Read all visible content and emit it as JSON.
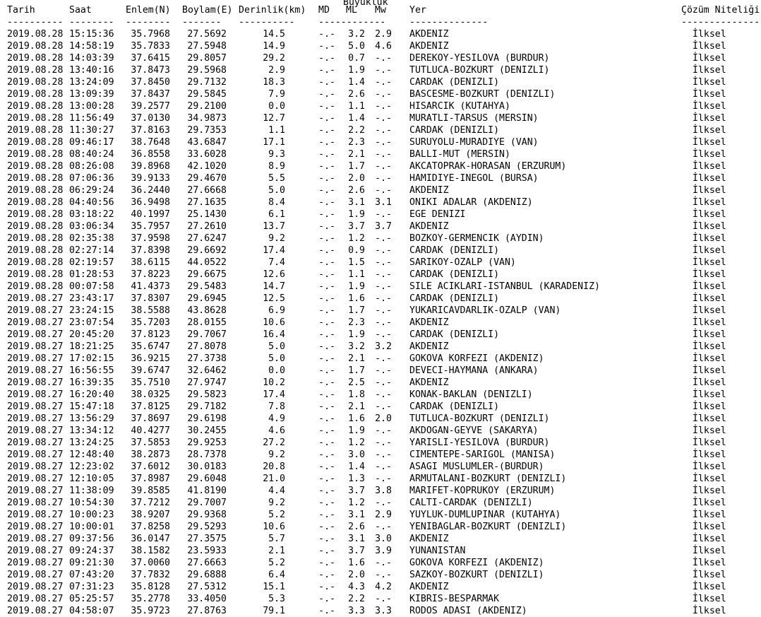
{
  "headers": {
    "magnitude_group": "Büyüklük",
    "date": "Tarih",
    "time": "Saat",
    "lat": "Enlem(N)",
    "lon": "Boylam(E)",
    "depth": "Derinlik(km)",
    "md": "MD",
    "ml": "ML",
    "mw": "Mw",
    "place": "Yer",
    "solution": "Çözüm Niteliği"
  },
  "dividers": {
    "date": "----------",
    "time": "--------",
    "lat": "--------",
    "lon": "-------",
    "depth": "----------",
    "mag": "------------",
    "place": "--------------",
    "solution": "--------------"
  },
  "rows": [
    {
      "date": "2019.08.28",
      "time": "15:15:36",
      "lat": "35.7968",
      "lon": "27.5692",
      "depth": "14.5",
      "md": "-.-",
      "ml": "3.2",
      "mw": "2.9",
      "place": "AKDENIZ",
      "solution": "İlksel"
    },
    {
      "date": "2019.08.28",
      "time": "14:58:19",
      "lat": "35.7833",
      "lon": "27.5948",
      "depth": "14.9",
      "md": "-.-",
      "ml": "5.0",
      "mw": "4.6",
      "place": "AKDENIZ",
      "solution": "İlksel"
    },
    {
      "date": "2019.08.28",
      "time": "14:03:39",
      "lat": "37.6415",
      "lon": "29.8057",
      "depth": "29.2",
      "md": "-.-",
      "ml": "0.7",
      "mw": "-.-",
      "place": "DEREKOY-YESILOVA (BURDUR)",
      "solution": "İlksel"
    },
    {
      "date": "2019.08.28",
      "time": "13:40:16",
      "lat": "37.8473",
      "lon": "29.5968",
      "depth": "2.9",
      "md": "-.-",
      "ml": "1.9",
      "mw": "-.-",
      "place": "TUTLUCA-BOZKURT (DENIZLI)",
      "solution": "İlksel"
    },
    {
      "date": "2019.08.28",
      "time": "13:24:09",
      "lat": "37.8450",
      "lon": "29.7132",
      "depth": "18.3",
      "md": "-.-",
      "ml": "1.4",
      "mw": "-.-",
      "place": "CARDAK (DENIZLI)",
      "solution": "İlksel"
    },
    {
      "date": "2019.08.28",
      "time": "13:09:39",
      "lat": "37.8437",
      "lon": "29.5845",
      "depth": "7.9",
      "md": "-.-",
      "ml": "2.6",
      "mw": "-.-",
      "place": "BASCESME-BOZKURT (DENIZLI)",
      "solution": "İlksel"
    },
    {
      "date": "2019.08.28",
      "time": "13:00:28",
      "lat": "39.2577",
      "lon": "29.2100",
      "depth": "0.0",
      "md": "-.-",
      "ml": "1.1",
      "mw": "-.-",
      "place": "HISARCIK (KUTAHYA)",
      "solution": "İlksel"
    },
    {
      "date": "2019.08.28",
      "time": "11:56:49",
      "lat": "37.0130",
      "lon": "34.9873",
      "depth": "12.7",
      "md": "-.-",
      "ml": "1.4",
      "mw": "-.-",
      "place": "MURATLI-TARSUS (MERSIN)",
      "solution": "İlksel"
    },
    {
      "date": "2019.08.28",
      "time": "11:30:27",
      "lat": "37.8163",
      "lon": "29.7353",
      "depth": "1.1",
      "md": "-.-",
      "ml": "2.2",
      "mw": "-.-",
      "place": "CARDAK (DENIZLI)",
      "solution": "İlksel"
    },
    {
      "date": "2019.08.28",
      "time": "09:46:17",
      "lat": "38.7648",
      "lon": "43.6847",
      "depth": "17.1",
      "md": "-.-",
      "ml": "2.3",
      "mw": "-.-",
      "place": "SURUYOLU-MURADIYE (VAN)",
      "solution": "İlksel"
    },
    {
      "date": "2019.08.28",
      "time": "08:40:24",
      "lat": "36.8558",
      "lon": "33.6028",
      "depth": "9.3",
      "md": "-.-",
      "ml": "2.1",
      "mw": "-.-",
      "place": "BALLI-MUT (MERSIN)",
      "solution": "İlksel"
    },
    {
      "date": "2019.08.28",
      "time": "08:26:08",
      "lat": "39.8968",
      "lon": "42.1020",
      "depth": "8.9",
      "md": "-.-",
      "ml": "1.7",
      "mw": "-.-",
      "place": "AKCATOPRAK-HORASAN (ERZURUM)",
      "solution": "İlksel"
    },
    {
      "date": "2019.08.28",
      "time": "07:06:36",
      "lat": "39.9133",
      "lon": "29.4670",
      "depth": "5.5",
      "md": "-.-",
      "ml": "2.0",
      "mw": "-.-",
      "place": "HAMIDIYE-INEGOL (BURSA)",
      "solution": "İlksel"
    },
    {
      "date": "2019.08.28",
      "time": "06:29:24",
      "lat": "36.2440",
      "lon": "27.6668",
      "depth": "5.0",
      "md": "-.-",
      "ml": "2.6",
      "mw": "-.-",
      "place": "AKDENIZ",
      "solution": "İlksel"
    },
    {
      "date": "2019.08.28",
      "time": "04:40:56",
      "lat": "36.9498",
      "lon": "27.1635",
      "depth": "8.4",
      "md": "-.-",
      "ml": "3.1",
      "mw": "3.1",
      "place": "ONIKI ADALAR (AKDENIZ)",
      "solution": "İlksel"
    },
    {
      "date": "2019.08.28",
      "time": "03:18:22",
      "lat": "40.1997",
      "lon": "25.1430",
      "depth": "6.1",
      "md": "-.-",
      "ml": "1.9",
      "mw": "-.-",
      "place": "EGE DENIZI",
      "solution": "İlksel"
    },
    {
      "date": "2019.08.28",
      "time": "03:06:34",
      "lat": "35.7957",
      "lon": "27.2610",
      "depth": "13.7",
      "md": "-.-",
      "ml": "3.7",
      "mw": "3.7",
      "place": "AKDENIZ",
      "solution": "İlksel"
    },
    {
      "date": "2019.08.28",
      "time": "02:35:38",
      "lat": "37.9598",
      "lon": "27.6247",
      "depth": "9.2",
      "md": "-.-",
      "ml": "1.2",
      "mw": "-.-",
      "place": "BOZKOY-GERMENCIK (AYDIN)",
      "solution": "İlksel"
    },
    {
      "date": "2019.08.28",
      "time": "02:27:14",
      "lat": "37.8398",
      "lon": "29.6692",
      "depth": "17.4",
      "md": "-.-",
      "ml": "0.9",
      "mw": "-.-",
      "place": "CARDAK (DENIZLI)",
      "solution": "İlksel"
    },
    {
      "date": "2019.08.28",
      "time": "02:19:57",
      "lat": "38.6115",
      "lon": "44.0522",
      "depth": "7.4",
      "md": "-.-",
      "ml": "1.5",
      "mw": "-.-",
      "place": "SARIKOY-OZALP (VAN)",
      "solution": "İlksel"
    },
    {
      "date": "2019.08.28",
      "time": "01:28:53",
      "lat": "37.8223",
      "lon": "29.6675",
      "depth": "12.6",
      "md": "-.-",
      "ml": "1.1",
      "mw": "-.-",
      "place": "CARDAK (DENIZLI)",
      "solution": "İlksel"
    },
    {
      "date": "2019.08.28",
      "time": "00:07:58",
      "lat": "41.4373",
      "lon": "29.5483",
      "depth": "14.7",
      "md": "-.-",
      "ml": "1.9",
      "mw": "-.-",
      "place": "SILE ACIKLARI-ISTANBUL (KARADENIZ)",
      "solution": "İlksel"
    },
    {
      "date": "2019.08.27",
      "time": "23:43:17",
      "lat": "37.8307",
      "lon": "29.6945",
      "depth": "12.5",
      "md": "-.-",
      "ml": "1.6",
      "mw": "-.-",
      "place": "CARDAK (DENIZLI)",
      "solution": "İlksel"
    },
    {
      "date": "2019.08.27",
      "time": "23:24:15",
      "lat": "38.5588",
      "lon": "43.8628",
      "depth": "6.9",
      "md": "-.-",
      "ml": "1.7",
      "mw": "-.-",
      "place": "YUKARICAVDARLIK-OZALP (VAN)",
      "solution": "İlksel"
    },
    {
      "date": "2019.08.27",
      "time": "23:07:54",
      "lat": "35.7203",
      "lon": "28.0155",
      "depth": "10.6",
      "md": "-.-",
      "ml": "2.3",
      "mw": "-.-",
      "place": "AKDENIZ",
      "solution": "İlksel"
    },
    {
      "date": "2019.08.27",
      "time": "20:45:20",
      "lat": "37.8123",
      "lon": "29.7067",
      "depth": "16.4",
      "md": "-.-",
      "ml": "1.9",
      "mw": "-.-",
      "place": "CARDAK (DENIZLI)",
      "solution": "İlksel"
    },
    {
      "date": "2019.08.27",
      "time": "18:21:25",
      "lat": "35.6747",
      "lon": "27.8078",
      "depth": "5.0",
      "md": "-.-",
      "ml": "3.2",
      "mw": "3.2",
      "place": "AKDENIZ",
      "solution": "İlksel"
    },
    {
      "date": "2019.08.27",
      "time": "17:02:15",
      "lat": "36.9215",
      "lon": "27.3738",
      "depth": "5.0",
      "md": "-.-",
      "ml": "2.1",
      "mw": "-.-",
      "place": "GOKOVA KORFEZI (AKDENIZ)",
      "solution": "İlksel"
    },
    {
      "date": "2019.08.27",
      "time": "16:56:55",
      "lat": "39.6747",
      "lon": "32.6462",
      "depth": "0.0",
      "md": "-.-",
      "ml": "1.7",
      "mw": "-.-",
      "place": "DEVECI-HAYMANA (ANKARA)",
      "solution": "İlksel"
    },
    {
      "date": "2019.08.27",
      "time": "16:39:35",
      "lat": "35.7510",
      "lon": "27.9747",
      "depth": "10.2",
      "md": "-.-",
      "ml": "2.5",
      "mw": "-.-",
      "place": "AKDENIZ",
      "solution": "İlksel"
    },
    {
      "date": "2019.08.27",
      "time": "16:20:40",
      "lat": "38.0325",
      "lon": "29.5823",
      "depth": "17.4",
      "md": "-.-",
      "ml": "1.8",
      "mw": "-.-",
      "place": "KONAK-BAKLAN (DENIZLI)",
      "solution": "İlksel"
    },
    {
      "date": "2019.08.27",
      "time": "15:47:18",
      "lat": "37.8125",
      "lon": "29.7182",
      "depth": "7.8",
      "md": "-.-",
      "ml": "2.1",
      "mw": "-.-",
      "place": "CARDAK (DENIZLI)",
      "solution": "İlksel"
    },
    {
      "date": "2019.08.27",
      "time": "13:56:29",
      "lat": "37.8697",
      "lon": "29.6198",
      "depth": "4.9",
      "md": "-.-",
      "ml": "1.6",
      "mw": "2.0",
      "place": "TUTLUCA-BOZKURT (DENIZLI)",
      "solution": "İlksel"
    },
    {
      "date": "2019.08.27",
      "time": "13:34:12",
      "lat": "40.4277",
      "lon": "30.2455",
      "depth": "4.6",
      "md": "-.-",
      "ml": "1.9",
      "mw": "-.-",
      "place": "AKDOGAN-GEYVE (SAKARYA)",
      "solution": "İlksel"
    },
    {
      "date": "2019.08.27",
      "time": "13:24:25",
      "lat": "37.5853",
      "lon": "29.9253",
      "depth": "27.2",
      "md": "-.-",
      "ml": "1.2",
      "mw": "-.-",
      "place": "YARISLI-YESILOVA (BURDUR)",
      "solution": "İlksel"
    },
    {
      "date": "2019.08.27",
      "time": "12:48:40",
      "lat": "38.2873",
      "lon": "28.7378",
      "depth": "9.2",
      "md": "-.-",
      "ml": "3.0",
      "mw": "-.-",
      "place": "CIMENTEPE-SARIGOL (MANISA)",
      "solution": "İlksel"
    },
    {
      "date": "2019.08.27",
      "time": "12:23:02",
      "lat": "37.6012",
      "lon": "30.0183",
      "depth": "20.8",
      "md": "-.-",
      "ml": "1.4",
      "mw": "-.-",
      "place": "ASAGI MUSLUMLER-(BURDUR)",
      "solution": "İlksel"
    },
    {
      "date": "2019.08.27",
      "time": "12:10:05",
      "lat": "37.8987",
      "lon": "29.6048",
      "depth": "21.0",
      "md": "-.-",
      "ml": "1.3",
      "mw": "-.-",
      "place": "ARMUTALANI-BOZKURT (DENIZLI)",
      "solution": "İlksel"
    },
    {
      "date": "2019.08.27",
      "time": "11:38:09",
      "lat": "39.8585",
      "lon": "41.8190",
      "depth": "4.4",
      "md": "-.-",
      "ml": "3.7",
      "mw": "3.8",
      "place": "MARIFET-KOPRUKOY (ERZURUM)",
      "solution": "İlksel"
    },
    {
      "date": "2019.08.27",
      "time": "10:54:30",
      "lat": "37.7212",
      "lon": "29.7007",
      "depth": "9.2",
      "md": "-.-",
      "ml": "1.2",
      "mw": "-.-",
      "place": "CALTI-CARDAK (DENIZLI)",
      "solution": "İlksel"
    },
    {
      "date": "2019.08.27",
      "time": "10:00:23",
      "lat": "38.9207",
      "lon": "29.9368",
      "depth": "5.2",
      "md": "-.-",
      "ml": "3.1",
      "mw": "2.9",
      "place": "YUYLUK-DUMLUPINAR (KUTAHYA)",
      "solution": "İlksel"
    },
    {
      "date": "2019.08.27",
      "time": "10:00:01",
      "lat": "37.8258",
      "lon": "29.5293",
      "depth": "10.6",
      "md": "-.-",
      "ml": "2.6",
      "mw": "-.-",
      "place": "YENIBAGLAR-BOZKURT (DENIZLI)",
      "solution": "İlksel"
    },
    {
      "date": "2019.08.27",
      "time": "09:37:56",
      "lat": "36.0147",
      "lon": "27.3575",
      "depth": "5.7",
      "md": "-.-",
      "ml": "3.1",
      "mw": "3.0",
      "place": "AKDENIZ",
      "solution": "İlksel"
    },
    {
      "date": "2019.08.27",
      "time": "09:24:37",
      "lat": "38.1582",
      "lon": "23.5933",
      "depth": "2.1",
      "md": "-.-",
      "ml": "3.7",
      "mw": "3.9",
      "place": "YUNANISTAN",
      "solution": "İlksel"
    },
    {
      "date": "2019.08.27",
      "time": "09:21:30",
      "lat": "37.0060",
      "lon": "27.6663",
      "depth": "5.2",
      "md": "-.-",
      "ml": "1.6",
      "mw": "-.-",
      "place": "GOKOVA KORFEZI (AKDENIZ)",
      "solution": "İlksel"
    },
    {
      "date": "2019.08.27",
      "time": "07:43:20",
      "lat": "37.7832",
      "lon": "29.6888",
      "depth": "6.4",
      "md": "-.-",
      "ml": "2.0",
      "mw": "-.-",
      "place": "SAZKOY-BOZKURT (DENIZLI)",
      "solution": "İlksel"
    },
    {
      "date": "2019.08.27",
      "time": "07:31:23",
      "lat": "35.8128",
      "lon": "27.5312",
      "depth": "15.1",
      "md": "-.-",
      "ml": "4.3",
      "mw": "4.2",
      "place": "AKDENIZ",
      "solution": "İlksel"
    },
    {
      "date": "2019.08.27",
      "time": "05:25:57",
      "lat": "35.2778",
      "lon": "33.4050",
      "depth": "5.3",
      "md": "-.-",
      "ml": "2.2",
      "mw": "-.-",
      "place": "KIBRIS-BESPARMAK",
      "solution": "İlksel"
    },
    {
      "date": "2019.08.27",
      "time": "04:58:07",
      "lat": "35.9723",
      "lon": "27.8763",
      "depth": "79.1",
      "md": "-.-",
      "ml": "3.3",
      "mw": "3.3",
      "place": "RODOS ADASI (AKDENIZ)",
      "solution": "İlksel"
    }
  ]
}
